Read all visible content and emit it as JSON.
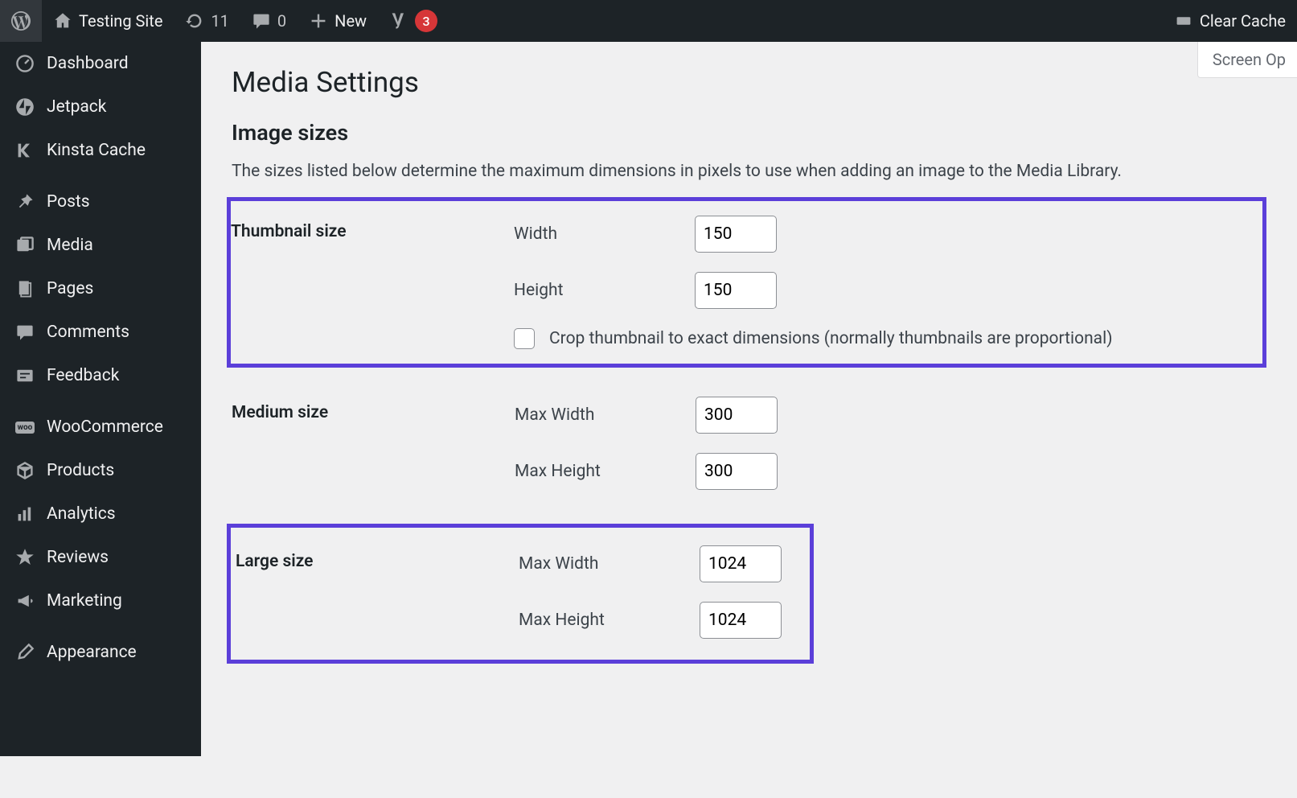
{
  "adminbar": {
    "site_name": "Testing Site",
    "refresh_count": "11",
    "comments_count": "0",
    "new_label": "New",
    "yoast_badge": "3",
    "clear_cache": "Clear Cache"
  },
  "sidebar": {
    "items": [
      {
        "label": "Dashboard"
      },
      {
        "label": "Jetpack"
      },
      {
        "label": "Kinsta Cache"
      },
      {
        "label": "Posts"
      },
      {
        "label": "Media"
      },
      {
        "label": "Pages"
      },
      {
        "label": "Comments"
      },
      {
        "label": "Feedback"
      },
      {
        "label": "WooCommerce"
      },
      {
        "label": "Products"
      },
      {
        "label": "Analytics"
      },
      {
        "label": "Reviews"
      },
      {
        "label": "Marketing"
      },
      {
        "label": "Appearance"
      }
    ]
  },
  "screen_options": "Screen Op",
  "page": {
    "title": "Media Settings",
    "section_title": "Image sizes",
    "description": "The sizes listed below determine the maximum dimensions in pixels to use when adding an image to the Media Library.",
    "thumbnail": {
      "heading": "Thumbnail size",
      "width_label": "Width",
      "width_value": "150",
      "height_label": "Height",
      "height_value": "150",
      "crop_label": "Crop thumbnail to exact dimensions (normally thumbnails are proportional)"
    },
    "medium": {
      "heading": "Medium size",
      "maxw_label": "Max Width",
      "maxw_value": "300",
      "maxh_label": "Max Height",
      "maxh_value": "300"
    },
    "large": {
      "heading": "Large size",
      "maxw_label": "Max Width",
      "maxw_value": "1024",
      "maxh_label": "Max Height",
      "maxh_value": "1024"
    }
  }
}
